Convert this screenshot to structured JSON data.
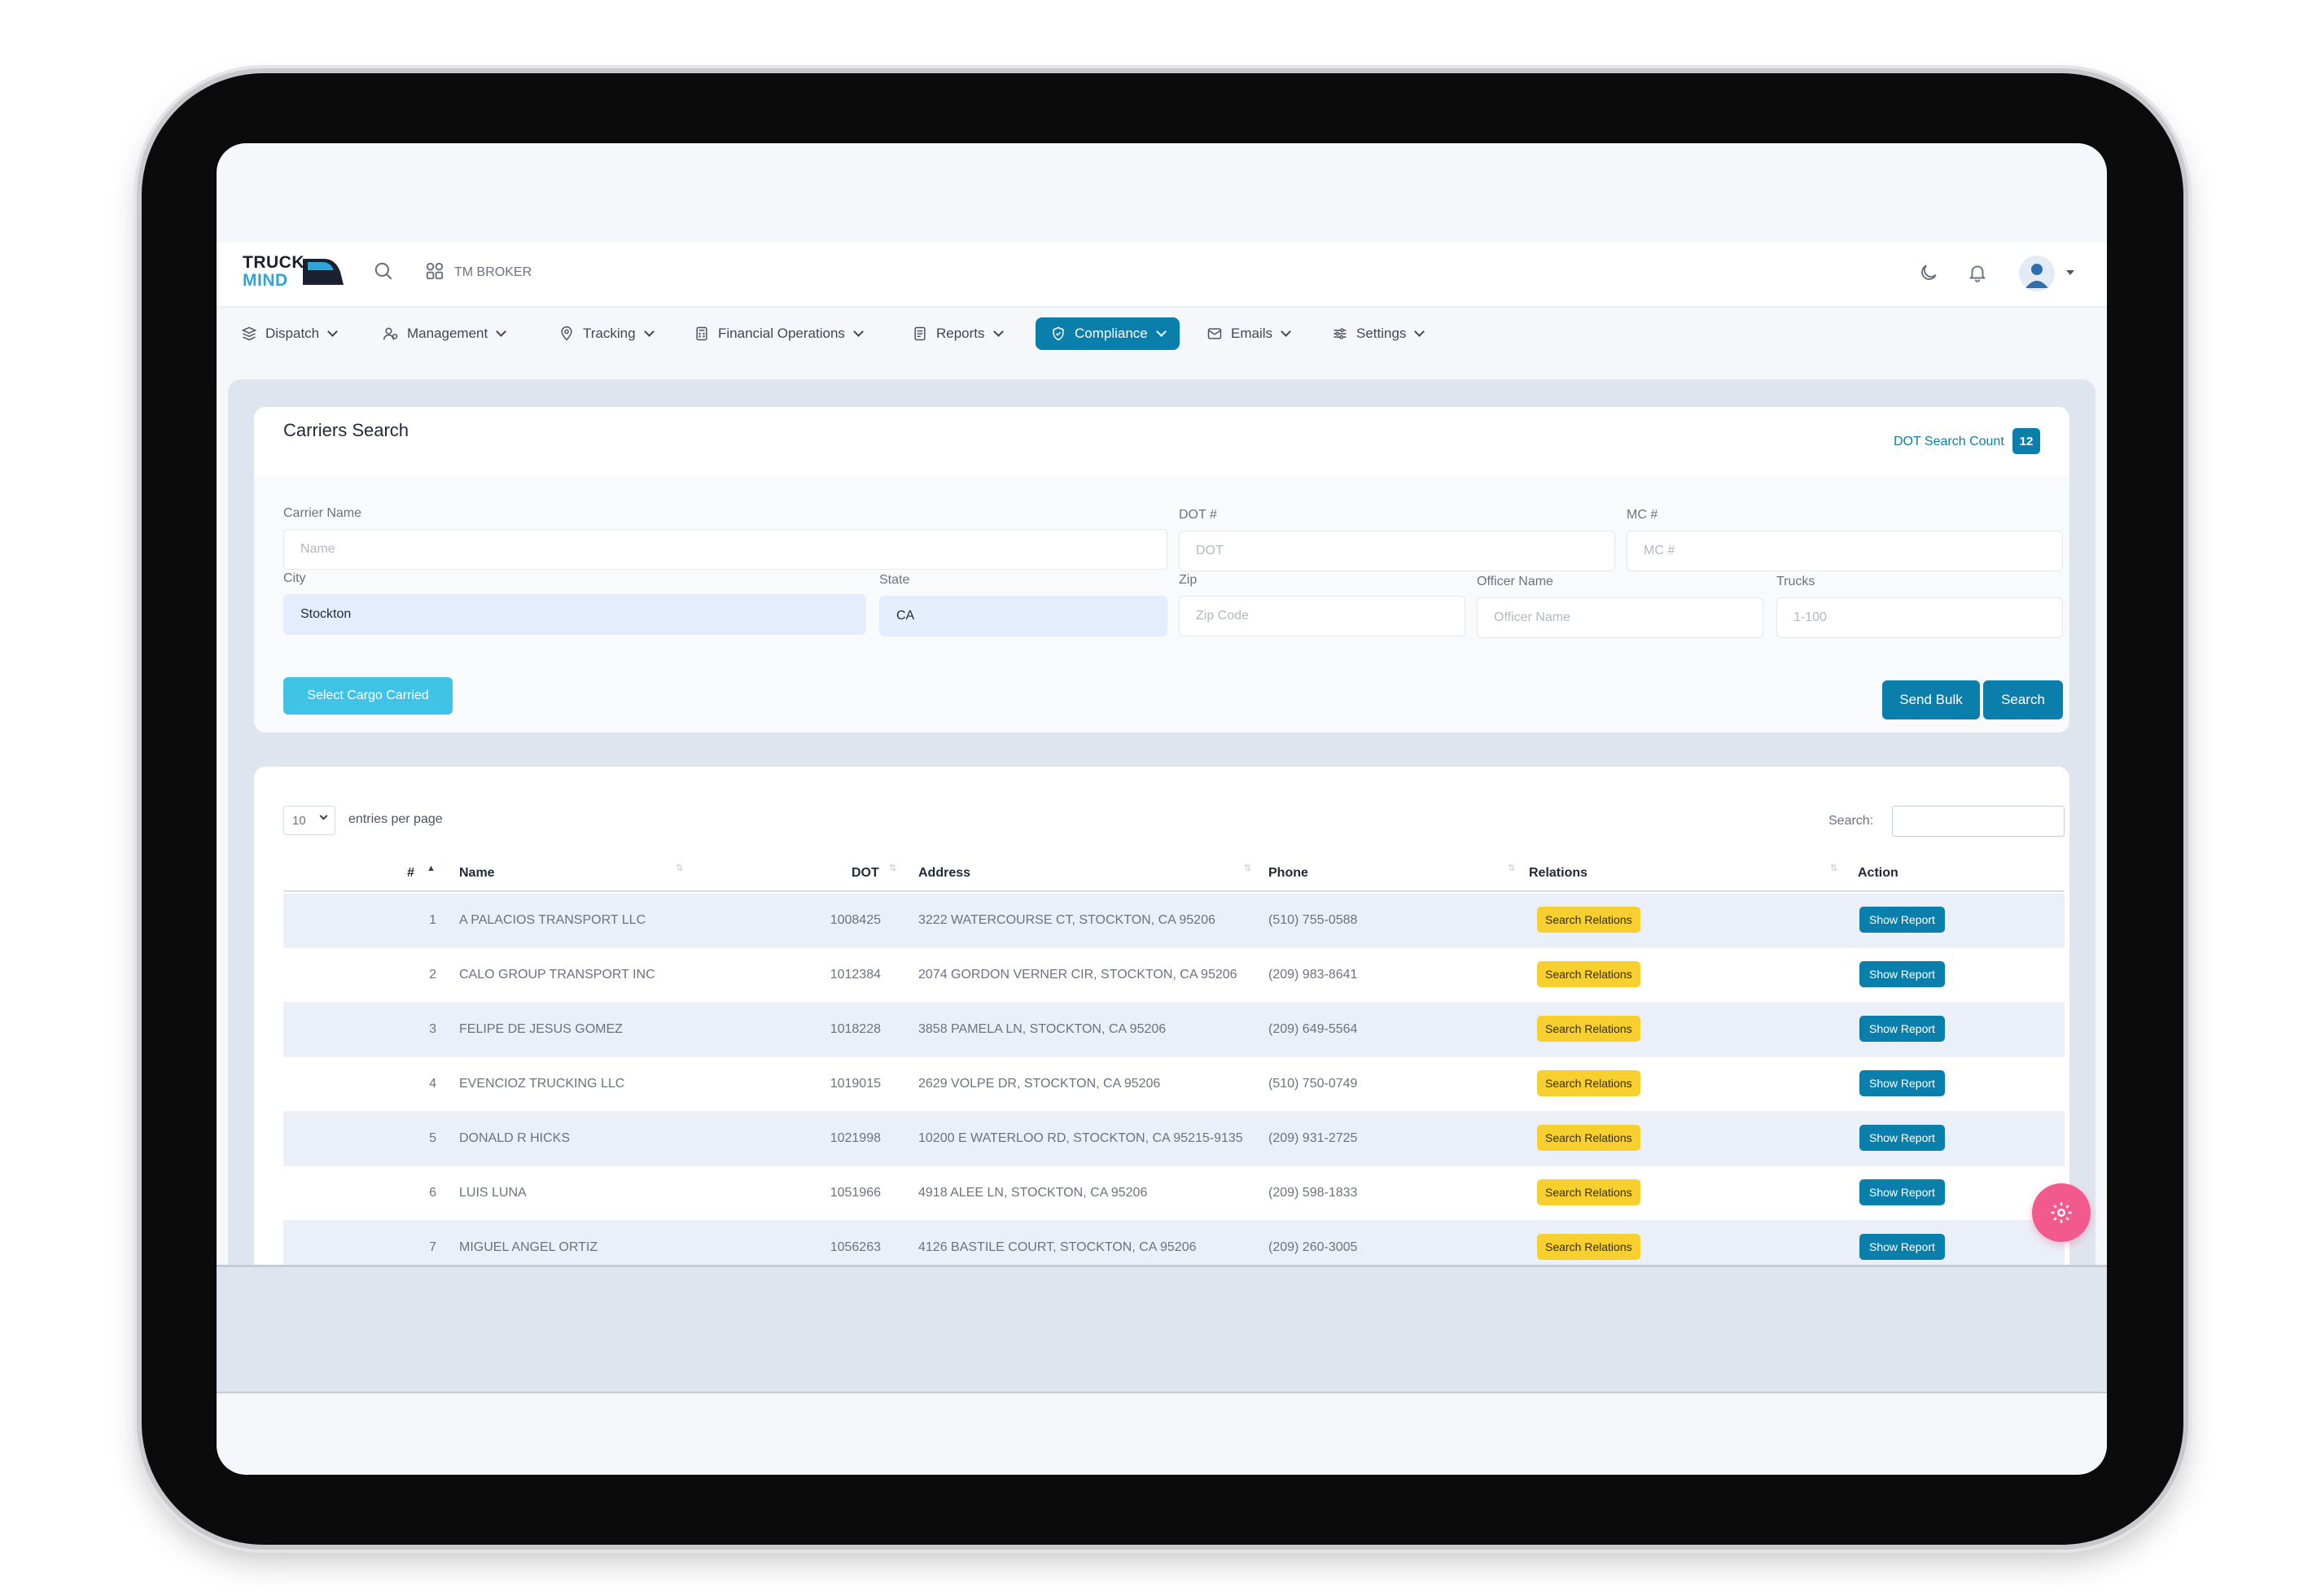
{
  "header": {
    "logo_line1": "TRUCK",
    "logo_line2": "MIND",
    "broker": "TM BROKER"
  },
  "nav": [
    {
      "label": "Dispatch",
      "icon": "dispatch-icon"
    },
    {
      "label": "Management",
      "icon": "users-icon"
    },
    {
      "label": "Tracking",
      "icon": "map-pin-icon"
    },
    {
      "label": "Financial Operations",
      "icon": "calculator-icon"
    },
    {
      "label": "Reports",
      "icon": "report-icon"
    },
    {
      "label": "Compliance",
      "icon": "shield-check-icon",
      "active": true
    },
    {
      "label": "Emails",
      "icon": "mail-icon"
    },
    {
      "label": "Settings",
      "icon": "sliders-icon"
    }
  ],
  "search_form": {
    "title": "Carriers Search",
    "dot_count_label": "DOT Search Count",
    "dot_count": "12",
    "fields": {
      "carrier_name": {
        "label": "Carrier Name",
        "placeholder": "Name",
        "value": ""
      },
      "dot": {
        "label": "DOT #",
        "placeholder": "DOT",
        "value": ""
      },
      "mc": {
        "label": "MC #",
        "placeholder": "MC #",
        "value": ""
      },
      "city": {
        "label": "City",
        "placeholder": "City",
        "value": "Stockton"
      },
      "state": {
        "label": "State",
        "placeholder": "State",
        "value": "CA"
      },
      "zip": {
        "label": "Zip",
        "placeholder": "Zip Code",
        "value": ""
      },
      "officer": {
        "label": "Officer Name",
        "placeholder": "Officer Name",
        "value": ""
      },
      "trucks": {
        "label": "Trucks",
        "placeholder": "1-100",
        "value": ""
      }
    },
    "cargo_button": "Select Cargo Carried",
    "send_bulk": "Send Bulk",
    "search": "Search"
  },
  "table": {
    "page_size": "10",
    "entries_label": "entries per page",
    "search_label": "Search:",
    "columns": [
      "#",
      "Name",
      "DOT",
      "Address",
      "Phone",
      "Relations",
      "Action"
    ],
    "rows": [
      {
        "num": "1",
        "name": "A PALACIOS TRANSPORT LLC",
        "dot": "1008425",
        "address": "3222 WATERCOURSE CT, STOCKTON, CA 95206",
        "phone": "(510) 755-0588",
        "relations": "Search Relations",
        "action": "Show Report"
      },
      {
        "num": "2",
        "name": "CALO GROUP TRANSPORT INC",
        "dot": "1012384",
        "address": "2074 GORDON VERNER CIR, STOCKTON, CA 95206",
        "phone": "(209) 983-8641",
        "relations": "Search Relations",
        "action": "Show Report"
      },
      {
        "num": "3",
        "name": "FELIPE DE JESUS GOMEZ",
        "dot": "1018228",
        "address": "3858 PAMELA LN, STOCKTON, CA 95206",
        "phone": "(209) 649-5564",
        "relations": "Search Relations",
        "action": "Show Report"
      },
      {
        "num": "4",
        "name": "EVENCIOZ TRUCKING LLC",
        "dot": "1019015",
        "address": "2629 VOLPE DR, STOCKTON, CA 95206",
        "phone": "(510) 750-0749",
        "relations": "Search Relations",
        "action": "Show Report"
      },
      {
        "num": "5",
        "name": "DONALD R HICKS",
        "dot": "1021998",
        "address": "10200 E WATERLOO RD, STOCKTON, CA 95215-9135",
        "phone": "(209) 931-2725",
        "relations": "Search Relations",
        "action": "Show Report"
      },
      {
        "num": "6",
        "name": "LUIS LUNA",
        "dot": "1051966",
        "address": "4918 ALEE LN, STOCKTON, CA 95206",
        "phone": "(209) 598-1833",
        "relations": "Search Relations",
        "action": "Show Report"
      },
      {
        "num": "7",
        "name": "MIGUEL ANGEL ORTIZ",
        "dot": "1056263",
        "address": "4126 BASTILE COURT, STOCKTON, CA 95206",
        "phone": "(209) 260-3005",
        "relations": "Search Relations",
        "action": "Show Report"
      }
    ]
  },
  "colors": {
    "primary": "#0b7fab",
    "accent_cyan": "#3fc4e8",
    "relations_yellow": "#f7cf2e",
    "fab_pink": "#f25a8e"
  }
}
